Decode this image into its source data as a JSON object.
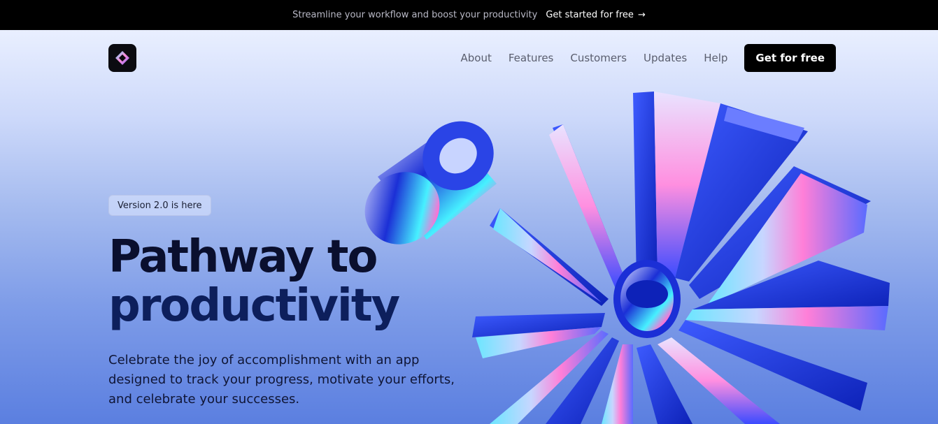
{
  "announcement": {
    "message": "Streamline your workflow and boost your productivity",
    "cta_label": "Get started for free",
    "cta_icon": "arrow-right-icon"
  },
  "brand": {
    "logo_icon": "diamond-logo-icon"
  },
  "nav": {
    "items": [
      {
        "label": "About"
      },
      {
        "label": "Features"
      },
      {
        "label": "Customers"
      },
      {
        "label": "Updates"
      },
      {
        "label": "Help"
      }
    ],
    "cta_label": "Get for free"
  },
  "hero": {
    "badge": "Version 2.0 is here",
    "title_line1": "Pathway to",
    "title_line2": "productivity",
    "description": "Celebrate the joy of accomplishment with an app designed to track your progress, motivate your efforts, and celebrate your successes."
  },
  "colors": {
    "topbar_bg": "#000000",
    "accent": "#1f3bdd",
    "text_dark": "#0a0f2e"
  }
}
